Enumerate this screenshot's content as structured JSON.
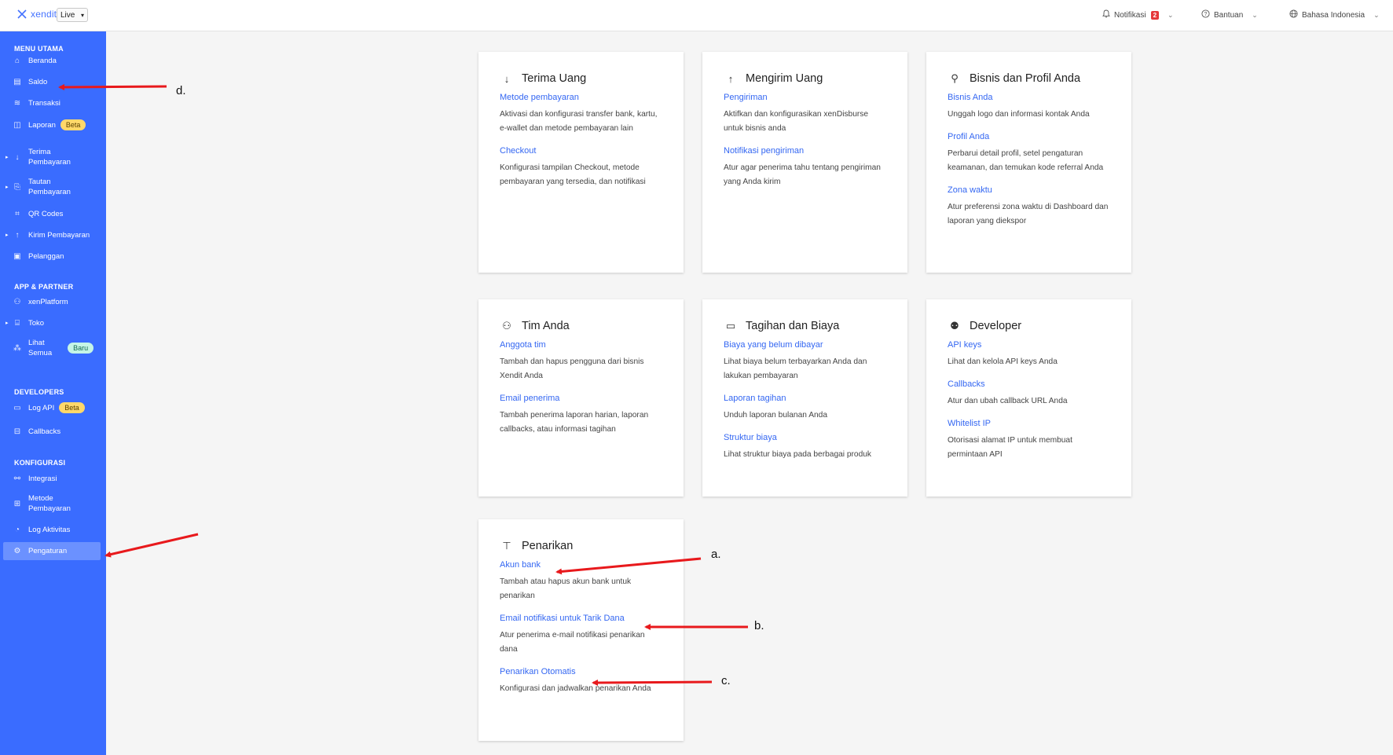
{
  "topbar": {
    "logo_text": "xendit",
    "env_value": "Live",
    "notif_label": "Notifikasi",
    "notif_count": "2",
    "help_label": "Bantuan",
    "lang_label": "Bahasa Indonesia"
  },
  "sidebar": {
    "sections": {
      "main": "MENU UTAMA",
      "apps": "APP & PARTNER",
      "dev": "DEVELOPERS",
      "config": "KONFIGURASI"
    },
    "items": {
      "beranda": "Beranda",
      "saldo": "Saldo",
      "transaksi": "Transaksi",
      "laporan": "Laporan",
      "laporan_badge": "Beta",
      "terima_1": "Terima",
      "terima_2": "Pembayaran",
      "tautan_1": "Tautan",
      "tautan_2": "Pembayaran",
      "qr": "QR Codes",
      "kirim": "Kirim Pembayaran",
      "pelanggan": "Pelanggan",
      "xenplatform": "xenPlatform",
      "toko": "Toko",
      "lihat_1": "Lihat",
      "lihat_2": "Semua",
      "lihat_badge": "Baru",
      "logapi": "Log API",
      "logapi_badge": "Beta",
      "callbacks": "Callbacks",
      "integrasi": "Integrasi",
      "metode_1": "Metode",
      "metode_2": "Pembayaran",
      "logaktivitas": "Log Aktivitas",
      "pengaturan": "Pengaturan"
    }
  },
  "cards": {
    "terima": {
      "title": "Terima Uang",
      "l1": "Metode pembayaran",
      "d1": "Aktivasi dan konfigurasi transfer bank, kartu, e-wallet dan metode pembayaran lain",
      "l2": "Checkout",
      "d2": "Konfigurasi tampilan Checkout, metode pembayaran yang tersedia, dan notifikasi"
    },
    "mengirim": {
      "title": "Mengirim Uang",
      "l1": "Pengiriman",
      "d1": "Aktifkan dan konfigurasikan xenDisburse untuk bisnis anda",
      "l2": "Notifikasi pengiriman",
      "d2": "Atur agar penerima tahu tentang pengiriman yang Anda kirim"
    },
    "bisnis": {
      "title": "Bisnis dan Profil Anda",
      "l1": "Bisnis Anda",
      "d1": "Unggah logo dan informasi kontak Anda",
      "l2": "Profil Anda",
      "d2": "Perbarui detail profil, setel pengaturan keamanan, dan temukan kode referral Anda",
      "l3": "Zona waktu",
      "d3": "Atur preferensi zona waktu di Dashboard dan laporan yang diekspor"
    },
    "tim": {
      "title": "Tim Anda",
      "l1": "Anggota tim",
      "d1": "Tambah dan hapus pengguna dari bisnis Xendit Anda",
      "l2": "Email penerima",
      "d2": "Tambah penerima laporan harian, laporan callbacks, atau informasi tagihan"
    },
    "tagihan": {
      "title": "Tagihan dan Biaya",
      "l1": "Biaya yang belum dibayar",
      "d1": "Lihat biaya belum terbayarkan Anda dan lakukan pembayaran",
      "l2": "Laporan tagihan",
      "d2": "Unduh laporan bulanan Anda",
      "l3": "Struktur biaya",
      "d3": "Lihat struktur biaya pada berbagai produk"
    },
    "developer": {
      "title": "Developer",
      "l1": "API keys",
      "d1": "Lihat dan kelola API keys Anda",
      "l2": "Callbacks",
      "d2": "Atur dan ubah callback URL Anda",
      "l3": "Whitelist IP",
      "d3": "Otorisasi alamat IP untuk membuat permintaan API"
    },
    "penarikan": {
      "title": "Penarikan",
      "l1": "Akun bank",
      "d1": "Tambah atau hapus akun bank untuk penarikan",
      "l2": "Email notifikasi untuk Tarik Dana",
      "d2": "Atur penerima e-mail notifikasi penarikan dana",
      "l3": "Penarikan Otomatis",
      "d3": "Konfigurasi dan jadwalkan penarikan Anda"
    }
  },
  "annotations": {
    "a": "a.",
    "b": "b.",
    "c": "c.",
    "d": "d."
  },
  "colors": {
    "sidebar": "#3a6cff",
    "link": "#3467f2",
    "arrow": "#e8191c"
  }
}
